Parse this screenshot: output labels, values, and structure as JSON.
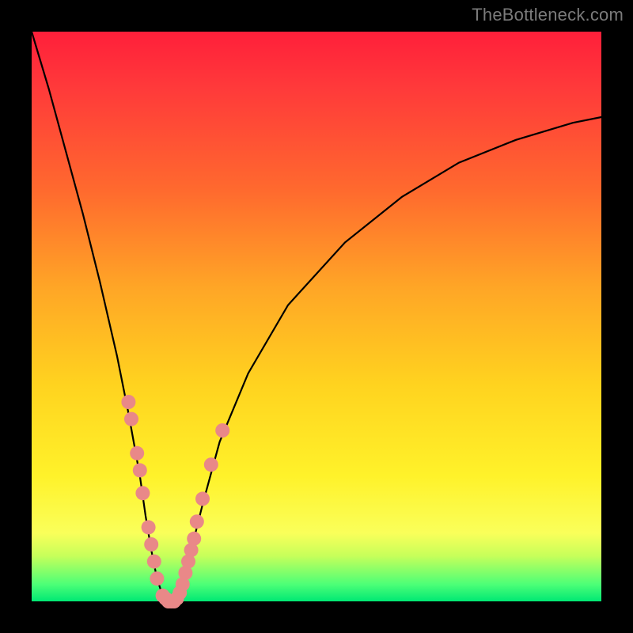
{
  "watermark": "TheBottleneck.com",
  "chart_data": {
    "type": "line",
    "title": "",
    "xlabel": "",
    "ylabel": "",
    "xlim": [
      0,
      100
    ],
    "ylim": [
      0,
      100
    ],
    "curve": {
      "x": [
        0,
        3,
        6,
        9,
        12,
        15,
        17,
        19,
        20,
        21,
        22,
        23,
        24,
        25,
        26,
        27,
        28,
        30,
        33,
        38,
        45,
        55,
        65,
        75,
        85,
        95,
        100
      ],
      "y": [
        100,
        90,
        79,
        68,
        56,
        43,
        33,
        22,
        15,
        9,
        4,
        1,
        0,
        0,
        1,
        4,
        9,
        17,
        28,
        40,
        52,
        63,
        71,
        77,
        81,
        84,
        85
      ]
    },
    "markers": [
      {
        "x": 17.0,
        "y": 35
      },
      {
        "x": 17.5,
        "y": 32
      },
      {
        "x": 18.5,
        "y": 26
      },
      {
        "x": 19.0,
        "y": 23
      },
      {
        "x": 19.5,
        "y": 19
      },
      {
        "x": 20.5,
        "y": 13
      },
      {
        "x": 21.0,
        "y": 10
      },
      {
        "x": 21.5,
        "y": 7
      },
      {
        "x": 22.0,
        "y": 4
      },
      {
        "x": 23.0,
        "y": 1
      },
      {
        "x": 23.5,
        "y": 0.5
      },
      {
        "x": 24.0,
        "y": 0
      },
      {
        "x": 24.5,
        "y": 0
      },
      {
        "x": 25.0,
        "y": 0
      },
      {
        "x": 25.5,
        "y": 0.5
      },
      {
        "x": 26.0,
        "y": 1.5
      },
      {
        "x": 26.5,
        "y": 3
      },
      {
        "x": 27.0,
        "y": 5
      },
      {
        "x": 27.5,
        "y": 7
      },
      {
        "x": 28.0,
        "y": 9
      },
      {
        "x": 28.5,
        "y": 11
      },
      {
        "x": 29.0,
        "y": 14
      },
      {
        "x": 30.0,
        "y": 18
      },
      {
        "x": 31.5,
        "y": 24
      },
      {
        "x": 33.5,
        "y": 30
      }
    ],
    "marker_style": {
      "color": "#e98888",
      "radius_px": 9
    }
  }
}
